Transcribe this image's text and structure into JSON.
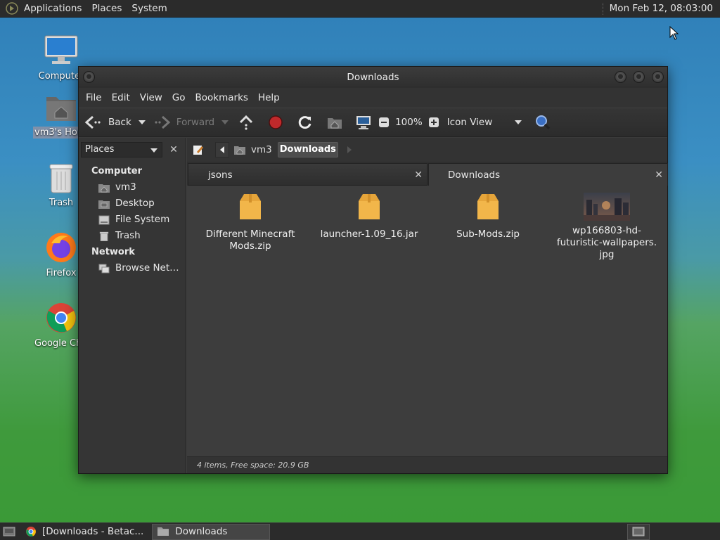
{
  "top_panel": {
    "menus": [
      "Applications",
      "Places",
      "System"
    ],
    "clock": "Mon Feb 12, 08:03:00"
  },
  "desktop": {
    "icons": [
      {
        "label": "Computer"
      },
      {
        "label": "vm3's Home"
      },
      {
        "label": "Trash"
      },
      {
        "label": "Firefox"
      },
      {
        "label": "Google Chrome"
      }
    ]
  },
  "window": {
    "title": "Downloads",
    "menubar": [
      "File",
      "Edit",
      "View",
      "Go",
      "Bookmarks",
      "Help"
    ],
    "toolbar": {
      "back": "Back",
      "forward": "Forward",
      "zoom": "100%",
      "view_mode": "Icon View"
    },
    "sidebar": {
      "selector": "Places",
      "sections": [
        {
          "heading": "Computer",
          "items": [
            "vm3",
            "Desktop",
            "File System",
            "Trash"
          ]
        },
        {
          "heading": "Network",
          "items": [
            "Browse Net…"
          ]
        }
      ]
    },
    "breadcrumb": [
      "vm3",
      "Downloads"
    ],
    "tabs": [
      "jsons",
      "Downloads"
    ],
    "files": [
      {
        "name_lines": [
          "Different Minecraft",
          "Mods.zip"
        ],
        "type": "archive"
      },
      {
        "name_lines": [
          "launcher-1.09_16.jar"
        ],
        "type": "archive"
      },
      {
        "name_lines": [
          "Sub-Mods.zip"
        ],
        "type": "archive"
      },
      {
        "name_lines": [
          "wp166803-hd-",
          "futuristic-wallpapers.",
          "jpg"
        ],
        "type": "image"
      }
    ],
    "status": "4 items, Free space: 20.9 GB"
  },
  "bottom_panel": {
    "tasks": [
      "[Downloads - Betac...",
      "Downloads"
    ]
  }
}
